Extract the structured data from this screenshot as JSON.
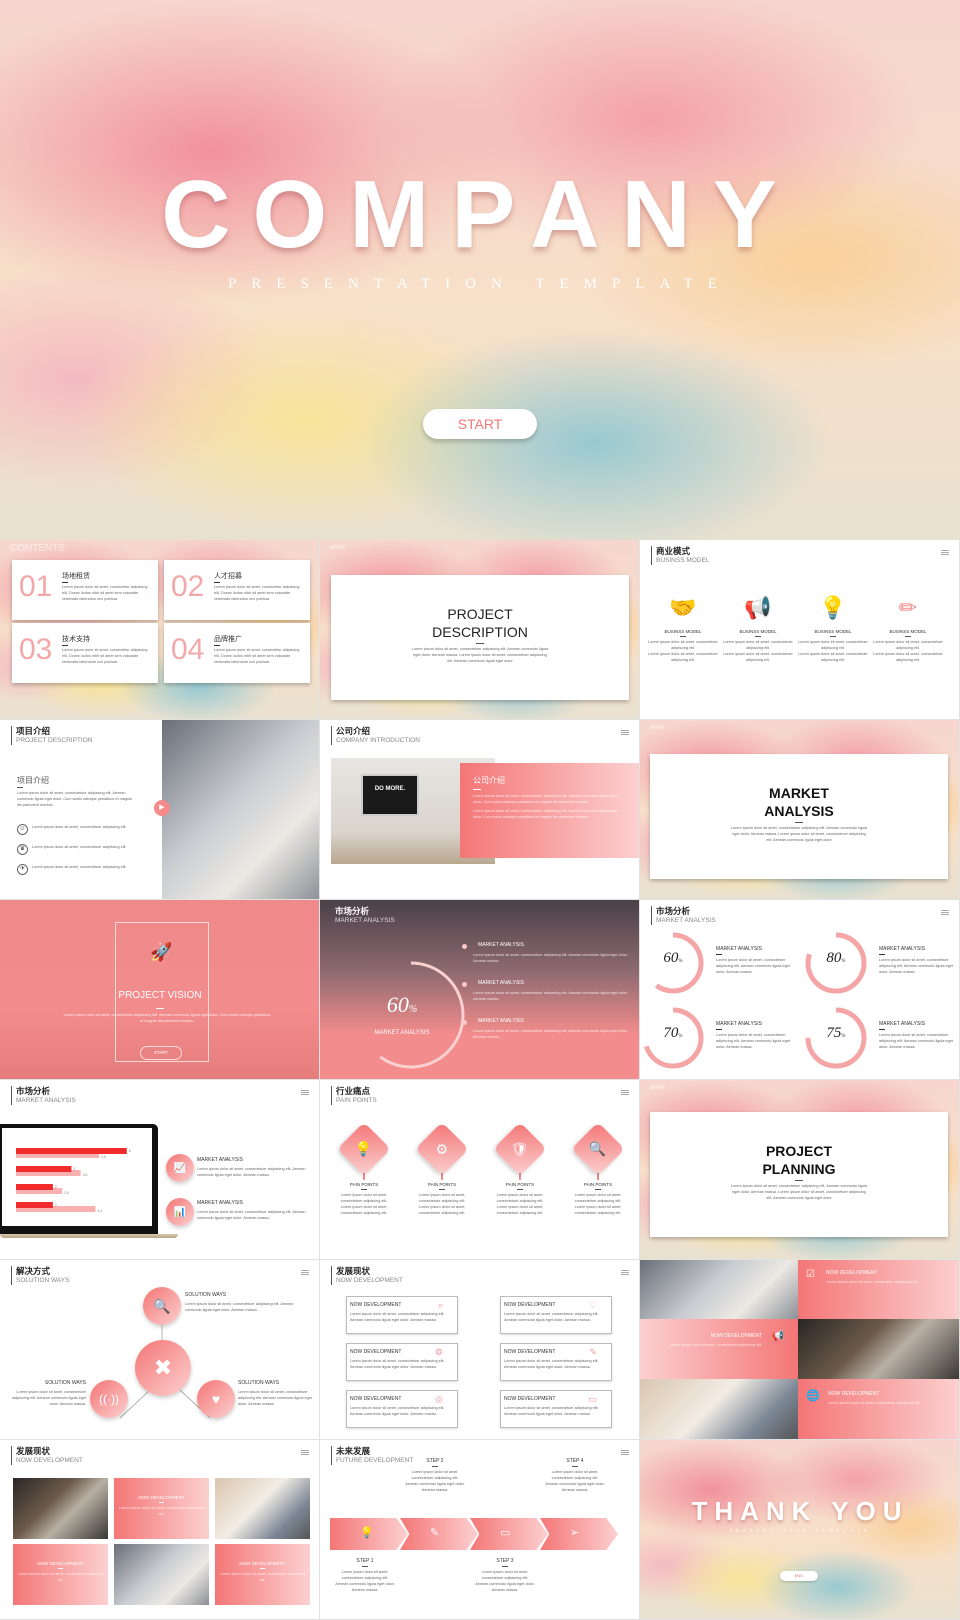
{
  "lorem": {
    "a": "Lorem ipsum dolor sit amet, consectetur adipiscing elit.",
    "b": "Donec luctus nibh sit amet sem vulputate venenatis",
    "c": "bibendum orci pulvinar.",
    "d": "Lorem ipsum dolor sit amet, consectetuer adipiscing elit. Aenean commodo ligula eget dolor. Aenean massa. Lorem ipsum dolor sit amet, consectetuer adipiscing elit. Aenean commodo ligula eget dolor",
    "e": "Lorem ipsum dolor sit amet, consectetuer adipiscing elit.",
    "f": "Aenean commodo ligula eget dolor. Aenean massa.",
    "g": "Lorem ipsum dolor sit amet, consectetuer adipiscing elit. Aenean commodo ligula eget dolor. Aenean massa.",
    "h": "Lorem ipsum dolor sit amet, consectetuer adipiscing elit. Aenean commodo ligula eget dolor. Cum sociis natoque penatibus et magnis dis parturient montes."
  },
  "hero": {
    "title": "COMPANY",
    "subtitle": "PRESENTATION TEMPLATE",
    "button": "START"
  },
  "contents": {
    "label": "CONTENTS",
    "items": [
      {
        "num": "01",
        "title": "场地租赁"
      },
      {
        "num": "02",
        "title": "人才招募"
      },
      {
        "num": "03",
        "title": "技术支持"
      },
      {
        "num": "04",
        "title": "品牌推广"
      }
    ]
  },
  "project_desc": {
    "tag": "MORE",
    "title1": "PROJECT",
    "title2": "DESCRIPTION"
  },
  "business": {
    "cn": "商业模式",
    "en": "BUSINSS MODEL",
    "item_label": "BUSINSS MODEL",
    "icons": [
      "handshake-icon",
      "megaphone-icon",
      "lightbulb-icon",
      "pencil-icon"
    ]
  },
  "project_intro": {
    "cn": "项目介绍",
    "en": "PROJECT DESCRIPTION",
    "sub": "项目介绍",
    "bullet": "Lorem ipsum dolor sit amet, consectetuer adipiscing elit."
  },
  "company_intro": {
    "cn": "公司介绍",
    "en": "COMPANY INTRODUCTION",
    "box_title": "公司介绍",
    "screen_text": "DO MORE."
  },
  "market_section": {
    "tag": "MORE",
    "title1": "MARKET",
    "title2": "ANALYSIS"
  },
  "vision": {
    "title": "PROJECT VISION",
    "button": "START"
  },
  "market_dark": {
    "cn": "市场分析",
    "en": "MARKET ANALYSIS",
    "value": 60,
    "value_label": "60",
    "unit": "%",
    "caption": "MARKET ANALYSIS",
    "item": "MARKET ANALYSIS"
  },
  "market_rings": {
    "cn": "市场分析",
    "en": "MARKET ANALYSIS",
    "item": "MARKET ANALYSIS",
    "values": [
      60,
      80,
      70,
      75
    ]
  },
  "market_bars": {
    "cn": "市场分析",
    "en": "MARKET ANALYSIS",
    "item": "MARKET ANALYSIS"
  },
  "chart_data": {
    "type": "bar",
    "orientation": "horizontal",
    "series": [
      {
        "values": [
          6,
          3,
          2,
          2
        ]
      },
      {
        "values": [
          4.5,
          3.5,
          2.5,
          4.3
        ]
      }
    ],
    "colors": [
      "#f22c2c",
      "#f9b0b0"
    ]
  },
  "pain": {
    "cn": "行业痛点",
    "en": "PAIN POINTS",
    "item": "PAIN POINTS",
    "icons": [
      "lightbulb-icon",
      "gears-icon",
      "shield-icon",
      "search-icon"
    ]
  },
  "planning": {
    "tag": "MORE",
    "title1": "PROJECT",
    "title2": "PLANNING"
  },
  "solution": {
    "cn": "解决方式",
    "en": "SOLUTION WAYS",
    "item": "SOLUTION WAYS"
  },
  "now_dev": {
    "cn": "发展现状",
    "en": "NOW DEVELOPMENT",
    "item": "NOW DEVELOPMENT"
  },
  "future": {
    "cn": "未来发展",
    "en": "FUTURE DEVELOPMENT",
    "steps": [
      "STEP 1",
      "STEP 2",
      "STEP 3",
      "STEP 4"
    ]
  },
  "thanks": {
    "title": "THANK YOU",
    "subtitle": "PRESENTATION TEMPLATE",
    "button": "END"
  },
  "colors": {
    "accent": "#f47676",
    "accent_light": "#fcd0d0",
    "text": "#222222"
  }
}
